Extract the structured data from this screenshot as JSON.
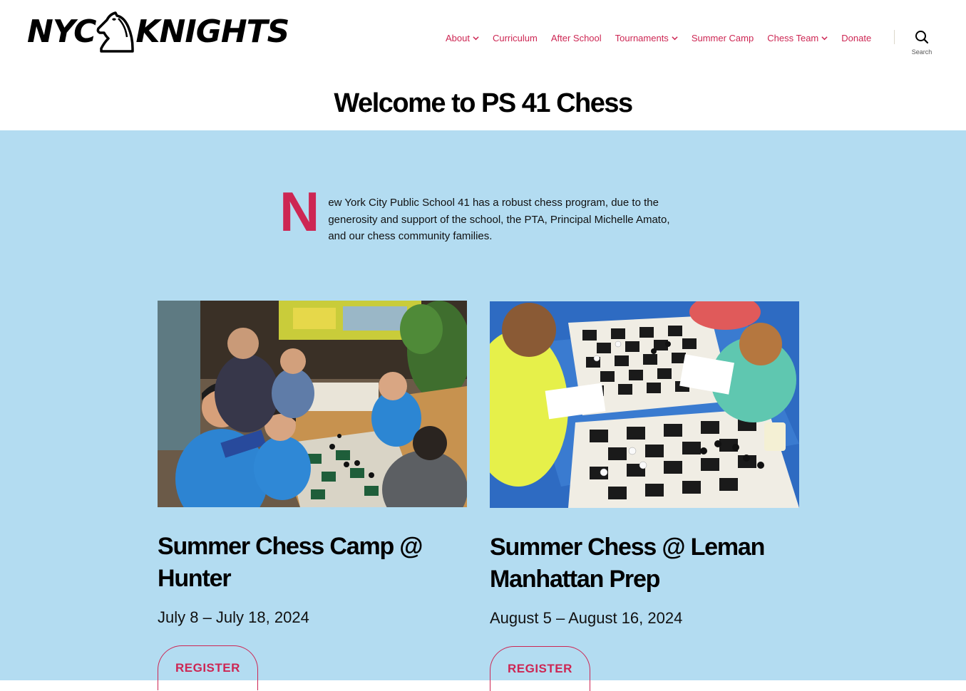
{
  "brand": {
    "logo_left": "NYC",
    "logo_right": "KNIGHTS",
    "logo_icon": "knight-horse-icon"
  },
  "nav": {
    "items": [
      {
        "label": "About",
        "has_dropdown": true
      },
      {
        "label": "Curriculum",
        "has_dropdown": false
      },
      {
        "label": "After School",
        "has_dropdown": false
      },
      {
        "label": "Tournaments",
        "has_dropdown": true
      },
      {
        "label": "Summer Camp",
        "has_dropdown": false
      },
      {
        "label": "Chess Team",
        "has_dropdown": true
      },
      {
        "label": "Donate",
        "has_dropdown": false
      }
    ],
    "search_label": "Search",
    "search_icon": "search-icon"
  },
  "page": {
    "title": "Welcome to PS 41 Chess"
  },
  "intro": {
    "dropcap": "N",
    "text": "ew York City Public School 41 has a robust chess program, due to the generosity and support of the school, the PTA, Principal Michelle Amato, and our chess community families."
  },
  "cards": [
    {
      "title": "Summer Chess Camp @ Hunter",
      "date": "July 8 – July 18, 2024",
      "button": "REGISTER",
      "image": "photo-kids-playing-chess-in-cafe"
    },
    {
      "title": "Summer Chess @ Leman Manhattan Prep",
      "date": "August 5 – August 16, 2024",
      "button": "REGISTER",
      "image": "photo-kids-playing-chess-on-blue-table"
    }
  ],
  "colors": {
    "accent": "#cd2653",
    "section_bg": "#b3dcf1",
    "header_bg": "#ffffff"
  }
}
